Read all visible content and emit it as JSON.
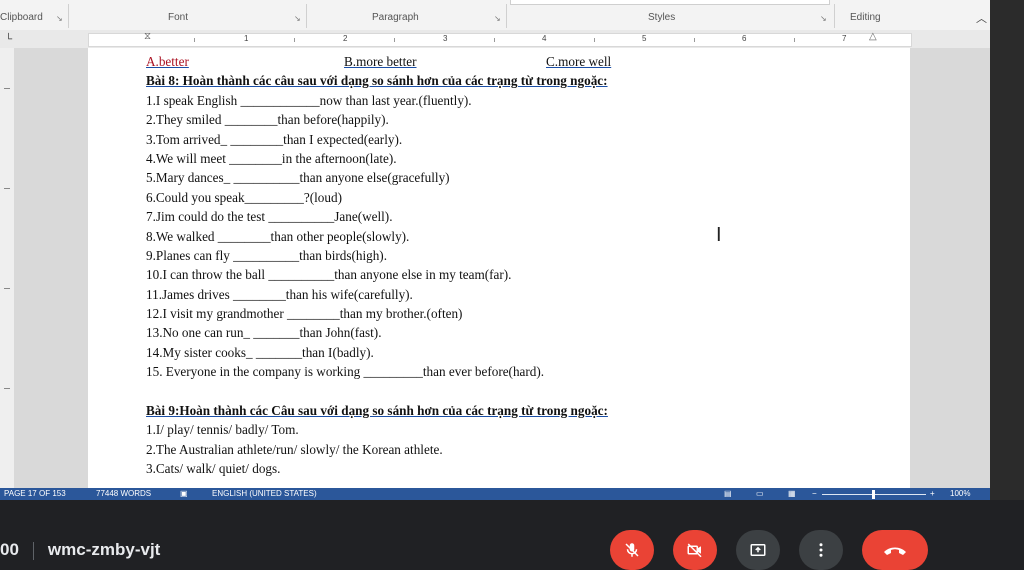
{
  "ribbon": {
    "groups": [
      "Clipboard",
      "Font",
      "Paragraph",
      "Styles",
      "Editing"
    ]
  },
  "ruler": {
    "numbers": [
      "1",
      "2",
      "3",
      "4",
      "5",
      "6",
      "7"
    ]
  },
  "document": {
    "options": [
      "A.better",
      "B.more better",
      "C.more well"
    ],
    "bai8_title": "Bài 8: Hoàn thành các câu sau  với dạng so sánh hơn của các trạng từ trong ngoặc:",
    "bai8_items": [
      "1.I speak English ____________now than last year.(fluently).",
      "2.They smiled ________than before(happily).",
      "3.Tom arrived_ ________than I expected(early).",
      "4.We will meet ________in the afternoon(late).",
      "5.Mary dances_ __________than anyone else(gracefully)",
      "6.Could you speak_________?(loud)",
      "7.Jim could  do the test __________Jane(well).",
      "8.We walked ________than other people(slowly).",
      "9.Planes can fly __________than birds(high).",
      "10.I can throw the ball __________than anyone else in my team(far).",
      "11.James drives ________than his wife(carefully).",
      "12.I visit my grandmother ________than my brother.(often)",
      "13.No one can run_ _______than John(fast).",
      "14.My sister cooks_ _______than I(badly).",
      "15. Everyone in the company is working _________than ever before(hard)."
    ],
    "bai9_title": "Bài 9:Hoàn thành các Câu sau với dạng so sánh hơn của các trạng từ trong ngoặc:",
    "bai9_items": [
      "1.I/ play/ tennis/ badly/ Tom.",
      "2.The Australian athlete/run/ slowly/ the Korean athlete.",
      "3.Cats/ walk/ quiet/ dogs."
    ]
  },
  "status_bar": {
    "page": "PAGE 17 OF 153",
    "words": "77448 WORDS",
    "language": "ENGLISH (UNITED STATES)",
    "zoom": "100%"
  },
  "meet": {
    "time": "00",
    "code": "wmc-zmby-vjt"
  },
  "colors": {
    "word_blue": "#2b579a",
    "meet_red": "#ea4335",
    "meet_gray": "#3c4043"
  }
}
